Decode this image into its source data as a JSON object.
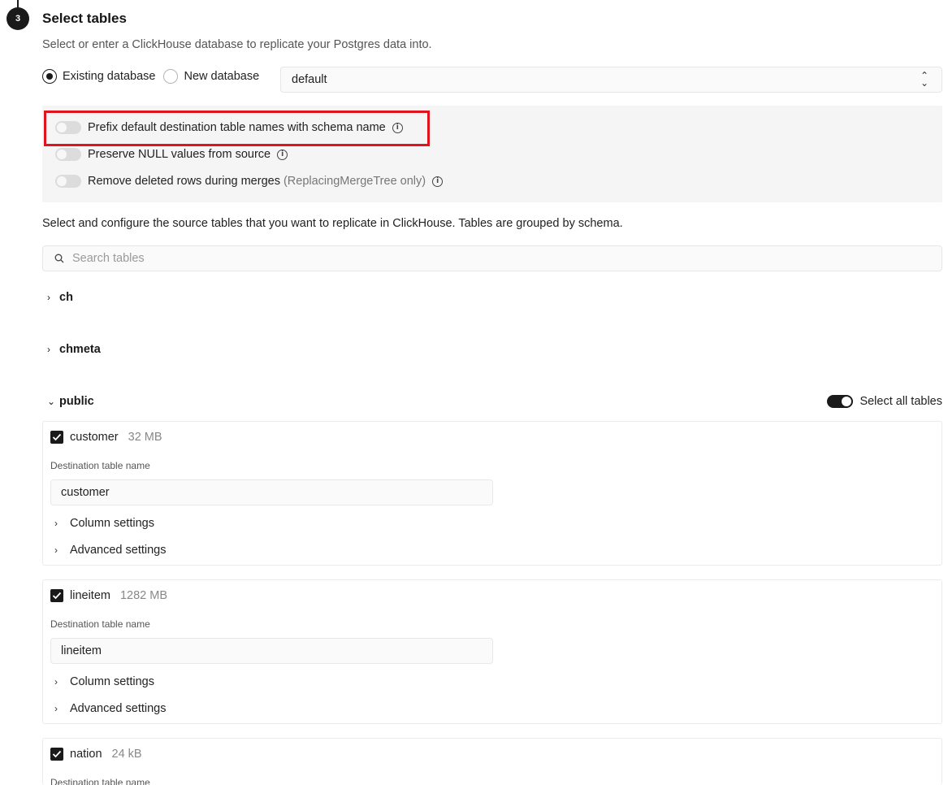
{
  "step": {
    "number": "3",
    "title": "Select tables",
    "subtitle": "Select or enter a ClickHouse database to replicate your Postgres data into."
  },
  "database": {
    "options": [
      {
        "label": "Existing database",
        "selected": true
      },
      {
        "label": "New database",
        "selected": false
      }
    ],
    "selected_value": "default"
  },
  "settings": [
    {
      "label": "Prefix default destination table names with schema name",
      "note": "",
      "enabled": false
    },
    {
      "label": "Preserve NULL values from source",
      "note": "",
      "enabled": false
    },
    {
      "label": "Remove deleted rows during merges",
      "note": "(ReplacingMergeTree only)",
      "enabled": false
    }
  ],
  "tables_section": {
    "description": "Select and configure the source tables that you want to replicate in ClickHouse. Tables are grouped by schema.",
    "search_placeholder": "Search tables"
  },
  "schemas": [
    {
      "name": "ch",
      "expanded": false
    },
    {
      "name": "chmeta",
      "expanded": false
    },
    {
      "name": "public",
      "expanded": true,
      "select_all_label": "Select all tables",
      "select_all_enabled": true
    }
  ],
  "tables": [
    {
      "name": "customer",
      "size": "32 MB",
      "checked": true,
      "dest_label": "Destination table name",
      "dest_value": "customer",
      "column_settings": "Column settings",
      "advanced_settings": "Advanced settings"
    },
    {
      "name": "lineitem",
      "size": "1282 MB",
      "checked": true,
      "dest_label": "Destination table name",
      "dest_value": "lineitem",
      "column_settings": "Column settings",
      "advanced_settings": "Advanced settings"
    },
    {
      "name": "nation",
      "size": "24 kB",
      "checked": true,
      "dest_label": "Destination table name"
    }
  ],
  "colors": {
    "primary": "#1a1a1a",
    "highlight": "#e0141e",
    "panel": "#f5f5f6"
  }
}
